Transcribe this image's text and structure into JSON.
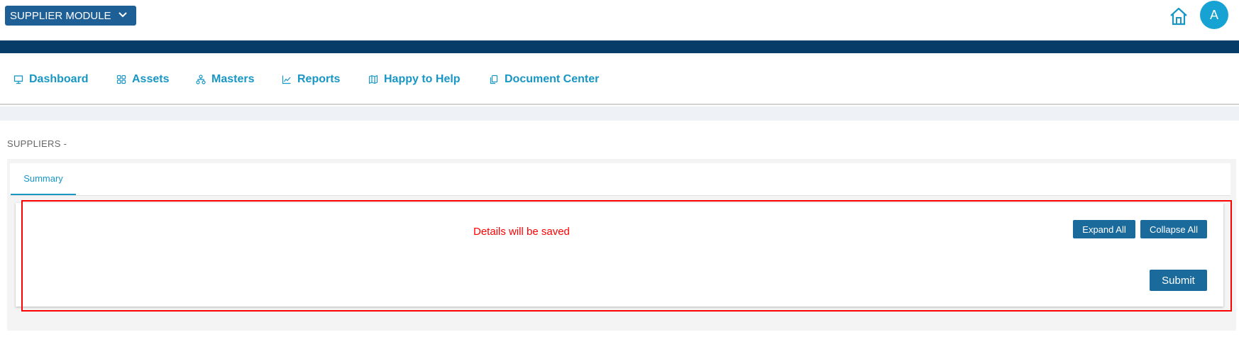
{
  "header": {
    "module_label": "SUPPLIER MODULE",
    "avatar_initial": "A"
  },
  "nav": {
    "items": [
      {
        "label": "Dashboard",
        "icon": "monitor-icon"
      },
      {
        "label": "Assets",
        "icon": "grid-icon"
      },
      {
        "label": "Masters",
        "icon": "hierarchy-icon"
      },
      {
        "label": "Reports",
        "icon": "line-chart-icon"
      },
      {
        "label": "Happy to Help",
        "icon": "map-icon"
      },
      {
        "label": "Document Center",
        "icon": "documents-icon"
      }
    ]
  },
  "page": {
    "title": "SUPPLIERS -",
    "tabs": [
      {
        "label": "Summary",
        "active": true
      }
    ]
  },
  "panel": {
    "message": "Details will be saved",
    "expand_label": "Expand All",
    "collapse_label": "Collapse All",
    "submit_label": "Submit"
  },
  "colors": {
    "brand_dark": "#053c68",
    "module_select": "#1e5f96",
    "accent": "#1896c4",
    "button": "#1a6b9c",
    "message": "#ff0000",
    "avatar": "#16a3d4"
  }
}
